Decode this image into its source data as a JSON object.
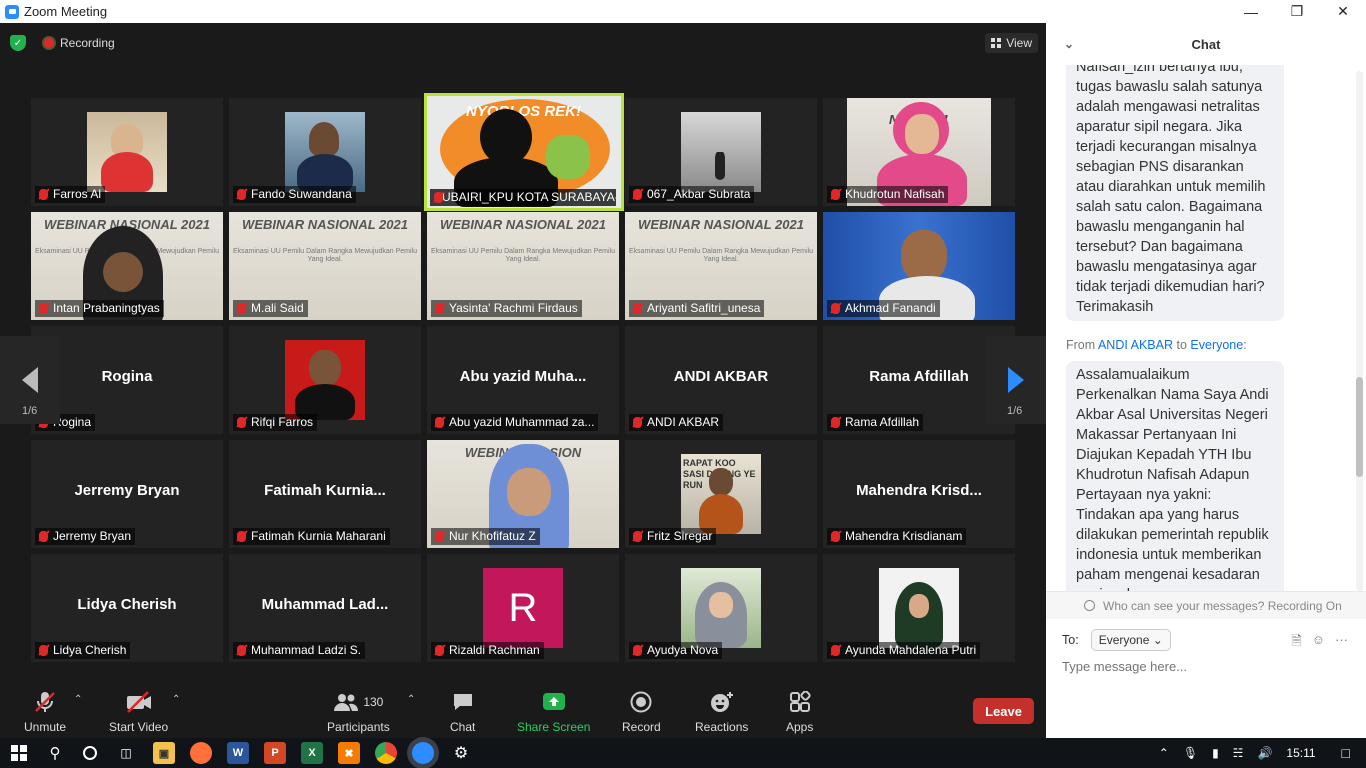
{
  "window": {
    "title": "Zoom Meeting",
    "minimize": "—",
    "maximize": "❐",
    "close": "✕"
  },
  "topbar": {
    "recording_label": "Recording",
    "view_label": "View"
  },
  "gallery": {
    "page_left": "1/6",
    "page_right": "1/6",
    "tiles": [
      {
        "name": "Farros Al"
      },
      {
        "name": "Fando Suwandana"
      },
      {
        "name": "SUBAIRI_KPU KOTA SURABAYA-",
        "active": true
      },
      {
        "name": "067_Akbar Subrata"
      },
      {
        "name": "Khudrotun Nafisah"
      },
      {
        "name": "Intan Prabaningtyas"
      },
      {
        "name": "M.ali Said"
      },
      {
        "name": "Yasinta' Rachmi Firdaus"
      },
      {
        "name": "Ariyanti Safitri_unesa"
      },
      {
        "name": "Akhmad Fanandi"
      },
      {
        "name": "Rogina",
        "display": "Rogina"
      },
      {
        "name": "Rifqi Farros"
      },
      {
        "name": "Abu yazid Muhammad za...",
        "display": "Abu yazid Muha..."
      },
      {
        "name": "ANDI AKBAR",
        "display": "ANDI AKBAR"
      },
      {
        "name": "Rama Afdillah",
        "display": "Rama Afdillah"
      },
      {
        "name": "Jerremy Bryan",
        "display": "Jerremy Bryan"
      },
      {
        "name": "Fatimah Kurnia Maharani",
        "display": "Fatimah Kurnia..."
      },
      {
        "name": "Nur Khofifatuz Z"
      },
      {
        "name": "Fritz Siregar"
      },
      {
        "name": "Mahendra Krisdianam",
        "display": "Mahendra Krisd..."
      },
      {
        "name": "Lidya Cherish",
        "display": "Lidya Cherish"
      },
      {
        "name": "Muhammad Ladzi S.",
        "display": "Muhammad Lad..."
      },
      {
        "name": "Rizaldi Rachman",
        "avatar_letter": "R"
      },
      {
        "name": "Ayudya Nova"
      },
      {
        "name": "Ayunda Mahdalena Putri"
      }
    ],
    "webinar_title": "WEBINAR NASIONAL 2021",
    "webinar_title_short": "WEBINAR NASION",
    "webinar_sub": "Eksaminasi UU Pemilu Dalam Rangka Mewujudkan Pemilu Yang Ideal.",
    "banner_text": "NYOBLOS REK!",
    "khudrotun_bg_text": "NAS 2021",
    "fritz_bg_text": "RAPAT KOO SASI DE ANG YE RUN"
  },
  "toolbar": {
    "unmute": "Unmute",
    "start_video": "Start Video",
    "participants": "Participants",
    "participants_count": "130",
    "chat": "Chat",
    "share_screen": "Share Screen",
    "record": "Record",
    "reactions": "Reactions",
    "apps": "Apps",
    "leave": "Leave",
    "caret": "⌃"
  },
  "chat": {
    "title": "Chat",
    "message1": "Nafisah_izin bertanya ibu, tugas bawaslu salah satunya adalah mengawasi netralitas aparatur sipil negara. Jika terjadi kecurangan misalnya sebagian PNS disarankan atau diarahkan untuk memilih salah satu calon. Bagaimana bawaslu menganganin hal tersebut? Dan bagaimana bawaslu mengatasinya agar tidak terjadi dikemudian hari? Terimakasih",
    "from_prefix": "From",
    "from_sender": "ANDI AKBAR",
    "from_to": "to",
    "from_recipient": "Everyone",
    "from_colon": ":",
    "message2": "Assalamualaikum Perkenalkan Nama Saya Andi Akbar Asal Universitas Negeri Makassar Pertanyaan Ini Diajukan Kepadah YTH Ibu Khudrotun Nafisah Adapun Pertayaan nya yakni: Tindakan apa yang harus dilakukan pemerintah republik indonesia untuk memberikan paham mengenai kesadaran nasional",
    "privacy": "Who can see your messages? Recording On",
    "to_label": "To:",
    "to_value": "Everyone",
    "placeholder": "Type message here..."
  },
  "taskbar": {
    "time": "15:11"
  }
}
